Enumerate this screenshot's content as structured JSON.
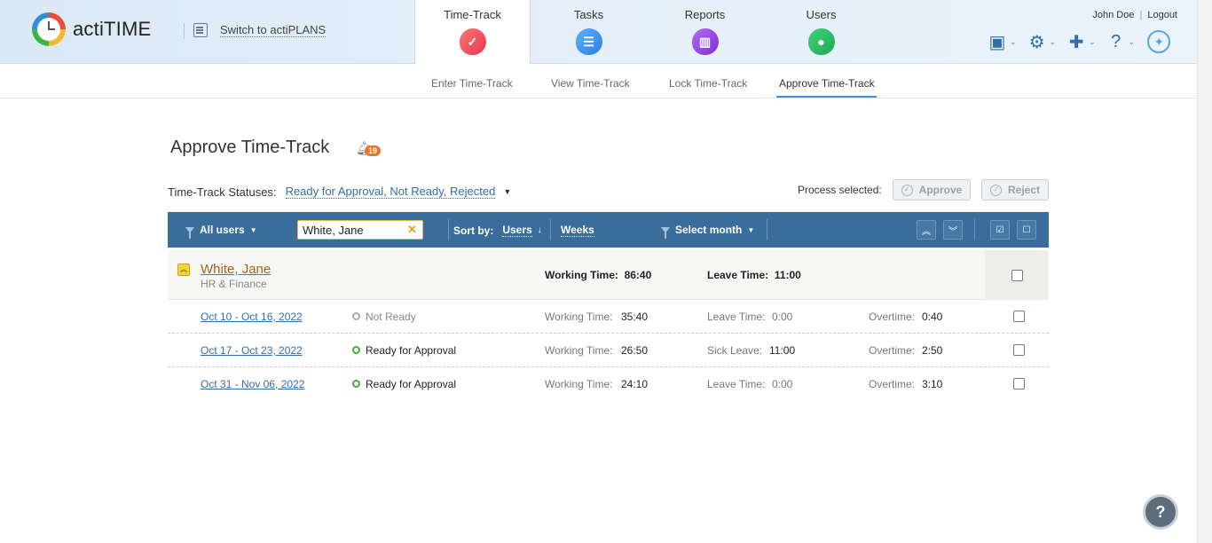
{
  "header": {
    "logo_text": "actiTIME",
    "switch_label": "Switch to actiPLANS",
    "user_name": "John Doe",
    "logout_label": "Logout",
    "main_tabs": [
      {
        "label": "Time-Track",
        "icon": "check-icon"
      },
      {
        "label": "Tasks",
        "icon": "list-icon"
      },
      {
        "label": "Reports",
        "icon": "bar-chart-icon"
      },
      {
        "label": "Users",
        "icon": "user-icon"
      }
    ],
    "tools": [
      "calendar-code-icon",
      "gear-icon",
      "puzzle-icon",
      "help-icon",
      "lightbulb-icon"
    ]
  },
  "subtabs": [
    "Enter Time-Track",
    "View Time-Track",
    "Lock Time-Track",
    "Approve Time-Track"
  ],
  "page": {
    "title": "Approve Time-Track",
    "notification_count": "19",
    "statuses_label": "Time-Track Statuses:",
    "statuses_value": "Ready for Approval, Not Ready, Rejected",
    "process_label": "Process selected:",
    "approve_label": "Approve",
    "reject_label": "Reject"
  },
  "filterbar": {
    "users_label": "All users",
    "search_value": "White, Jane",
    "sort_label": "Sort by:",
    "sort_value": "Users",
    "period_value": "Weeks",
    "month_label": "Select month"
  },
  "group": {
    "last_name": "White",
    "first_name": "Jane",
    "department": "HR & Finance",
    "working_label": "Working Time:",
    "working_value": "86:40",
    "leave_label": "Leave Time:",
    "leave_value": "11:00"
  },
  "weeks": [
    {
      "range": "Oct 10 - Oct 16, 2022",
      "status": "Not Ready",
      "working_label": "Working Time:",
      "working": "35:40",
      "leave_label": "Leave Time:",
      "leave": "0:00",
      "overtime_label": "Overtime:",
      "overtime": "0:40"
    },
    {
      "range": "Oct 17 - Oct 23, 2022",
      "status": "Ready for Approval",
      "working_label": "Working Time:",
      "working": "26:50",
      "leave_label": "Sick Leave:",
      "leave": "11:00",
      "overtime_label": "Overtime:",
      "overtime": "2:50"
    },
    {
      "range": "Oct 31 - Nov 06, 2022",
      "status": "Ready for Approval",
      "working_label": "Working Time:",
      "working": "24:10",
      "leave_label": "Leave Time:",
      "leave": "0:00",
      "overtime_label": "Overtime:",
      "overtime": "3:10"
    }
  ],
  "colors": {
    "accent": "#3a6d9a",
    "link": "#2f6ea8",
    "user_link": "#b05f12",
    "badge": "#e8772e",
    "ready": "#48a83a"
  }
}
